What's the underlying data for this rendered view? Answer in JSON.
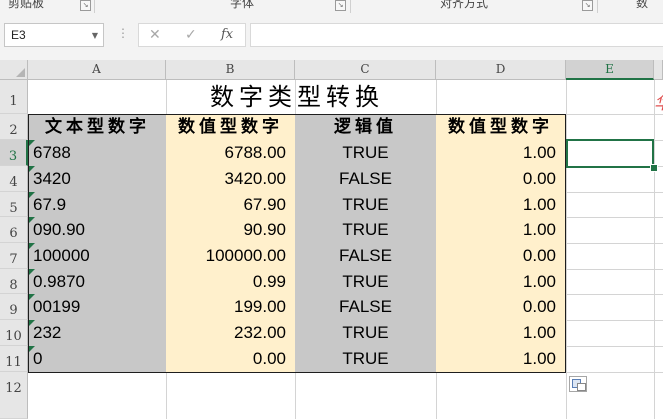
{
  "ribbon": {
    "groups": [
      "剪贴板",
      "字体",
      "对齐方式",
      "数"
    ]
  },
  "formula_bar": {
    "name_box": "E3",
    "cancel_icon": "close-icon",
    "enter_icon": "check-icon",
    "fx_label": "fx",
    "formula": ""
  },
  "columns": [
    "A",
    "B",
    "C",
    "D",
    "E"
  ],
  "rows": [
    "1",
    "2",
    "3",
    "4",
    "5",
    "6",
    "7",
    "8",
    "9",
    "10",
    "11",
    "12"
  ],
  "selected": {
    "column": "E",
    "row": "3"
  },
  "title": "数字类型转换",
  "overflow_text": "华",
  "headers": [
    "文本型数字",
    "数值型数字",
    "逻辑值",
    "数值型数字"
  ],
  "data_rows": [
    {
      "text": "6788",
      "number": "6788.00",
      "logic": "TRUE",
      "result": "1.00"
    },
    {
      "text": "3420",
      "number": "3420.00",
      "logic": "FALSE",
      "result": "0.00"
    },
    {
      "text": "67.9",
      "number": "67.90",
      "logic": "TRUE",
      "result": "1.00"
    },
    {
      "text": "090.90",
      "number": "90.90",
      "logic": "TRUE",
      "result": "1.00"
    },
    {
      "text": "100000",
      "number": "100000.00",
      "logic": "FALSE",
      "result": "0.00"
    },
    {
      "text": "0.9870",
      "number": "0.99",
      "logic": "TRUE",
      "result": "1.00"
    },
    {
      "text": "00199",
      "number": "199.00",
      "logic": "FALSE",
      "result": "0.00"
    },
    {
      "text": "232",
      "number": "232.00",
      "logic": "TRUE",
      "result": "1.00"
    },
    {
      "text": "0",
      "number": "0.00",
      "logic": "TRUE",
      "result": "1.00"
    }
  ],
  "colors": {
    "text_col_fill": "#c8c8c8",
    "number_col_fill": "#fff0cc",
    "selection": "#217346",
    "error_indicator": "#217346"
  }
}
